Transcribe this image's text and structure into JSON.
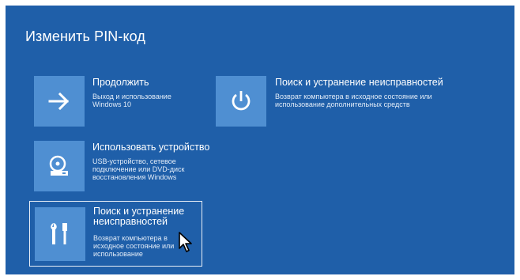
{
  "page": {
    "title": "Изменить PIN-код"
  },
  "options": {
    "continue": {
      "title": "Продолжить",
      "description": "Выход и использование Windows 10",
      "icon": "arrow-right-icon"
    },
    "use_device": {
      "title": "Использовать устройство",
      "description": "USB-устройство, сетевое подключение или DVD-диск восстановления Windows",
      "icon": "disc-drive-icon"
    },
    "troubleshoot_selected": {
      "title": "Поиск и устранение неисправностей",
      "description": "Возврат компьютера в исходное состояние или использование",
      "icon": "tools-icon"
    },
    "troubleshoot": {
      "title": "Поиск и устранение неисправностей",
      "description": "Возврат компьютера в исходное состояние или использование дополнительных средств",
      "icon": "power-icon"
    }
  },
  "colors": {
    "background": "#1f5fa9",
    "tile": "#4f8fd2",
    "text": "#ffffff"
  }
}
